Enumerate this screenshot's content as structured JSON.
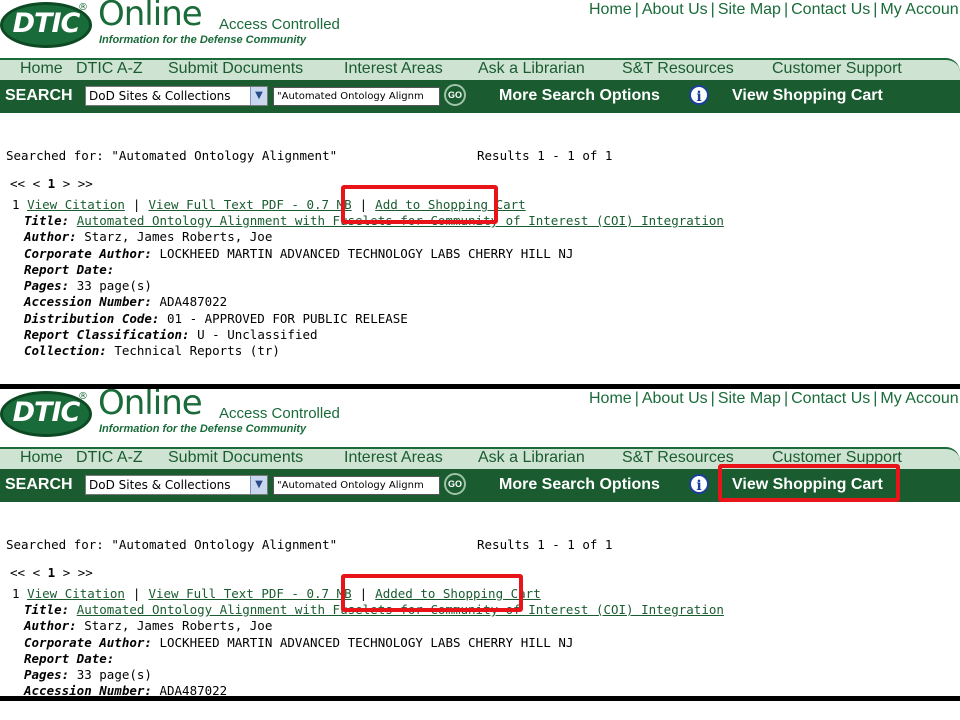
{
  "header": {
    "logo_text": "DTIC",
    "logo_reg": "®",
    "brand_online": "Online",
    "brand_access": "Access Controlled",
    "brand_tagline": "Information for the Defense Community",
    "top_links": [
      "Home",
      "About Us",
      "Site Map",
      "Contact Us",
      "My Accoun"
    ]
  },
  "nav": {
    "items": [
      "Home",
      "DTIC A-Z",
      "Submit Documents",
      "Interest Areas",
      "Ask a Librarian",
      "S&T Resources",
      "Customer Support"
    ]
  },
  "search": {
    "label": "SEARCH",
    "collection_selected": "DoD Sites & Collections",
    "query_value": "\"Automated Ontology Alignm",
    "go_label": "GO",
    "more_options": "More Search Options",
    "info_icon": "i",
    "view_cart": "View Shopping Cart"
  },
  "results": {
    "searched_for": "Searched for: \"Automated Ontology Alignment\"",
    "count": "Results 1 - 1 of 1",
    "pager_prev": "<< <",
    "pager_current": "1",
    "pager_next": "> >>",
    "item_number": "1",
    "view_citation": "View Citation",
    "sep": "|",
    "view_pdf": "View Full Text PDF - 0.7 MB",
    "title_label": "Title:",
    "title": "Automated Ontology Alignment with Fuselets for Community of Interest (COI) Integration",
    "author_label": "Author:",
    "author": "Starz, James Roberts, Joe",
    "corp_label": "Corporate Author:",
    "corp": "LOCKHEED MARTIN ADVANCED TECHNOLOGY LABS CHERRY HILL NJ",
    "date_label": "Report Date:",
    "pages_label": "Pages:",
    "pages": "33 page(s)",
    "accession_label": "Accession Number:",
    "accession": "ADA487022",
    "dist_label": "Distribution Code:",
    "dist": "01 - APPROVED FOR PUBLIC RELEASE",
    "class_label": "Report Classification:",
    "class": "U - Unclassified",
    "collection_label": "Collection:",
    "collection": "Technical Reports (tr)"
  },
  "panel1": {
    "cart_action": "Add to Shopping Cart"
  },
  "panel2": {
    "cart_action": "Added to Shopping Cart"
  },
  "colors": {
    "brand_green": "#1a5c30",
    "highlight_red": "#e8141a"
  }
}
